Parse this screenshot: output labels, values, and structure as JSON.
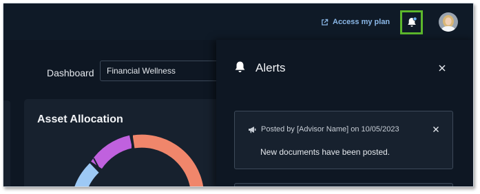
{
  "header": {
    "access_plan_label": "Access my plan"
  },
  "dashboard": {
    "label": "Dashboard",
    "selected_view": "Financial Wellness"
  },
  "asset_allocation": {
    "title": "Asset Allocation",
    "segment_colors": [
      "#f0866b",
      "#9dc9f5",
      "#c061de"
    ]
  },
  "alerts": {
    "title": "Alerts",
    "items": [
      {
        "posted_by": "Posted by [Advisor Name] on 10/05/2023",
        "message": "New documents have been posted."
      }
    ]
  },
  "colors": {
    "highlight": "#5cb82c",
    "accent_link": "#8bb8e8",
    "notification_dot": "#6fb2f0"
  }
}
